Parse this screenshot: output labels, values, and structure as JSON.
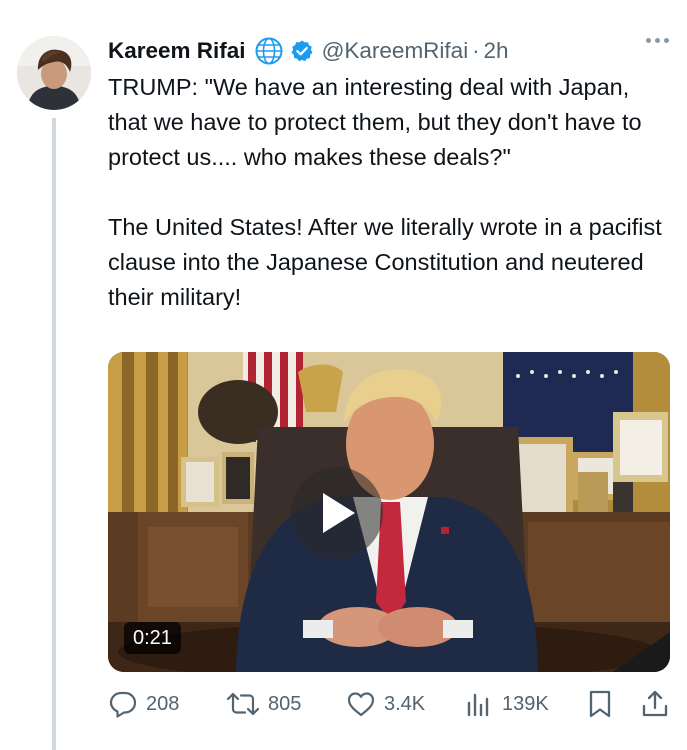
{
  "author": {
    "name": "Kareem Rifai",
    "handle": "@KareemRifai",
    "separator": "·",
    "time": "2h"
  },
  "icons": {
    "affiliate": "globe-icon",
    "verified": "verified-badge-icon",
    "more": "more-options-icon",
    "reply": "reply-icon",
    "repost": "repost-icon",
    "like": "heart-icon",
    "views": "views-icon",
    "bookmark": "bookmark-icon",
    "share": "share-icon",
    "play": "play-icon"
  },
  "tweet": {
    "paragraph1": "TRUMP: \"We have an interesting deal with Japan, that we have to protect them, but they don't have to protect us.... who makes these deals?\"",
    "paragraph2": "The United States! After we literally wrote in a pacifist clause into the Japanese Constitution and neutered their military!"
  },
  "media": {
    "type": "video",
    "duration": "0:21"
  },
  "actions": {
    "replies": "208",
    "reposts": "805",
    "likes": "3.4K",
    "views": "139K"
  },
  "colors": {
    "text": "#0f1419",
    "secondary": "#536471",
    "verified": "#1d9bf0",
    "thread_line": "#cfd9de"
  }
}
